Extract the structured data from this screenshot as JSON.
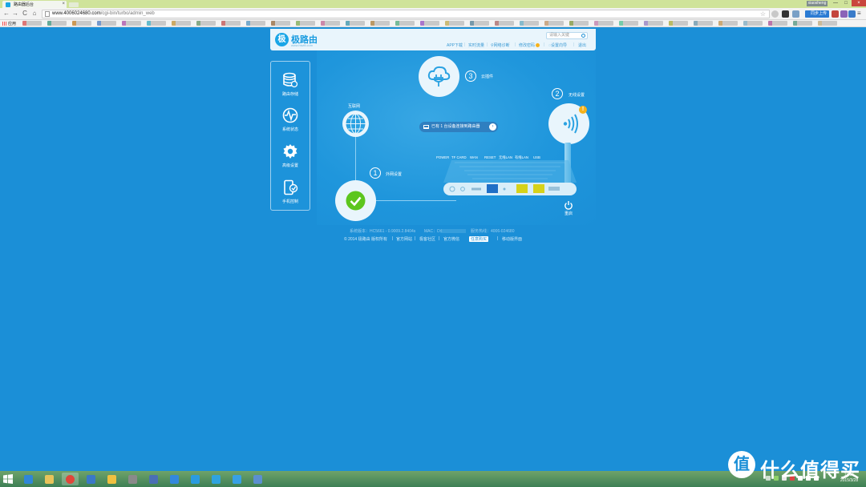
{
  "browser": {
    "tab_title": "路由器后台",
    "user_badge": "xiaosheng",
    "url_host": "www.4006024680.com",
    "url_path": "/cgi-bin/turbo/admin_web",
    "login_ext_label": "同步上传",
    "apps_label": "应用",
    "win_min": "—",
    "win_max": "□",
    "win_close": "×",
    "close_tab": "×",
    "back": "←",
    "forward": "→",
    "reload": "C",
    "home": "⌂",
    "star": "☆",
    "menu": "≡"
  },
  "header": {
    "logo_mark": "极",
    "logo_text": "极路由",
    "logo_url": "www.hiwifi.com",
    "search_placeholder": "请输入关键",
    "nav": {
      "app_download": "APP下载",
      "realtime_traffic": "实时流量",
      "network_diagnosis": "网络诊断",
      "update_firmware": "修改密码",
      "setup_guide": "设置向导",
      "logout": "退出",
      "separator": "|"
    }
  },
  "sidebar": {
    "items": [
      {
        "label": "路由存储"
      },
      {
        "label": "系统状态"
      },
      {
        "label": "高级设置"
      },
      {
        "label": "手机控制"
      }
    ]
  },
  "diagram": {
    "internet_label": "互联网",
    "step1_num": "1",
    "step1_label": "外网设置",
    "step2_num": "2",
    "step2_label": "无线设置",
    "step3_num": "3",
    "step3_label": "云插件",
    "devices_text": "已有 1 台设备连接到路由器",
    "arrow": "›",
    "warn": "!",
    "reset_label": "重启",
    "ports": [
      "POWER",
      "TF CARD",
      "WAN",
      "RESET",
      "无线LAN",
      "有线LAN",
      "USB"
    ]
  },
  "sysinfo": {
    "firmware": "系统版本：HC5661 - 0.9009.2.8404s",
    "mac": "MAC：D4",
    "hotline": "服务热线：4006-024680"
  },
  "footer": {
    "copyright": "© 2014 极路由 版权所有",
    "official_site": "官方网站",
    "community": "极客社区",
    "weibo": "官方微信",
    "buy": "任意购买",
    "mobile": "移动版界面",
    "sep": "|"
  },
  "taskbar": {
    "clock_time": "19:31",
    "clock_date": "2015/3/28"
  },
  "watermark": {
    "logo": "值",
    "text": "什么值得买"
  },
  "colors": {
    "page_bg": "#1b8fd7",
    "header_bg": "#e9f5fc",
    "accent": "#1aa6e7",
    "check_green": "#5cc61e",
    "port_blue": "#1f6fc6",
    "port_yellow": "#d6d21a",
    "warn": "#f6b21b"
  }
}
